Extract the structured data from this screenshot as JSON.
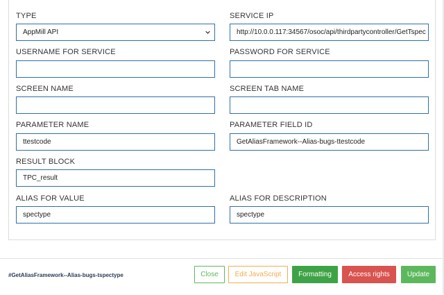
{
  "form": {
    "type_label": "TYPE",
    "type_value": "AppMill API",
    "service_ip_label": "SERVICE IP",
    "service_ip_value": "http://10.0.0.117:34567/osoc/api/thirdpartycontroller/GetTspec",
    "username_label": "USERNAME FOR SERVICE",
    "username_value": "",
    "password_label": "PASSWORD FOR SERVICE",
    "password_value": "",
    "screen_name_label": "SCREEN NAME",
    "screen_name_value": "",
    "screen_tab_label": "SCREEN TAB NAME",
    "screen_tab_value": "",
    "param_name_label": "PARAMETER NAME",
    "param_name_value": "ttestcode",
    "param_field_label": "PARAMETER FIELD ID",
    "param_field_value": "GetAliasFramework--Alias-bugs-ttestcode",
    "result_block_label": "RESULT BLOCK",
    "result_block_value": "TPC_result",
    "alias_value_label": "ALIAS FOR VALUE",
    "alias_value_value": "spectype",
    "alias_desc_label": "ALIAS FOR DESCRIPTION",
    "alias_desc_value": "spectype"
  },
  "footer": {
    "title": "#GetAliasFramework--Alias-bugs-tspectype",
    "close_label": "Close",
    "edit_js_label": "Edit JavaScript",
    "formatting_label": "Formatting",
    "access_rights_label": "Access rights",
    "update_label": "Update"
  },
  "icons": {
    "select_caret": "chevron-down-icon"
  },
  "colors": {
    "field_border": "#2f6fa8",
    "close": "#5cb85c",
    "edit_js": "#f0ad4e",
    "formatting": "#3ea346",
    "access_rights": "#d9534f",
    "update": "#5cb85c"
  }
}
